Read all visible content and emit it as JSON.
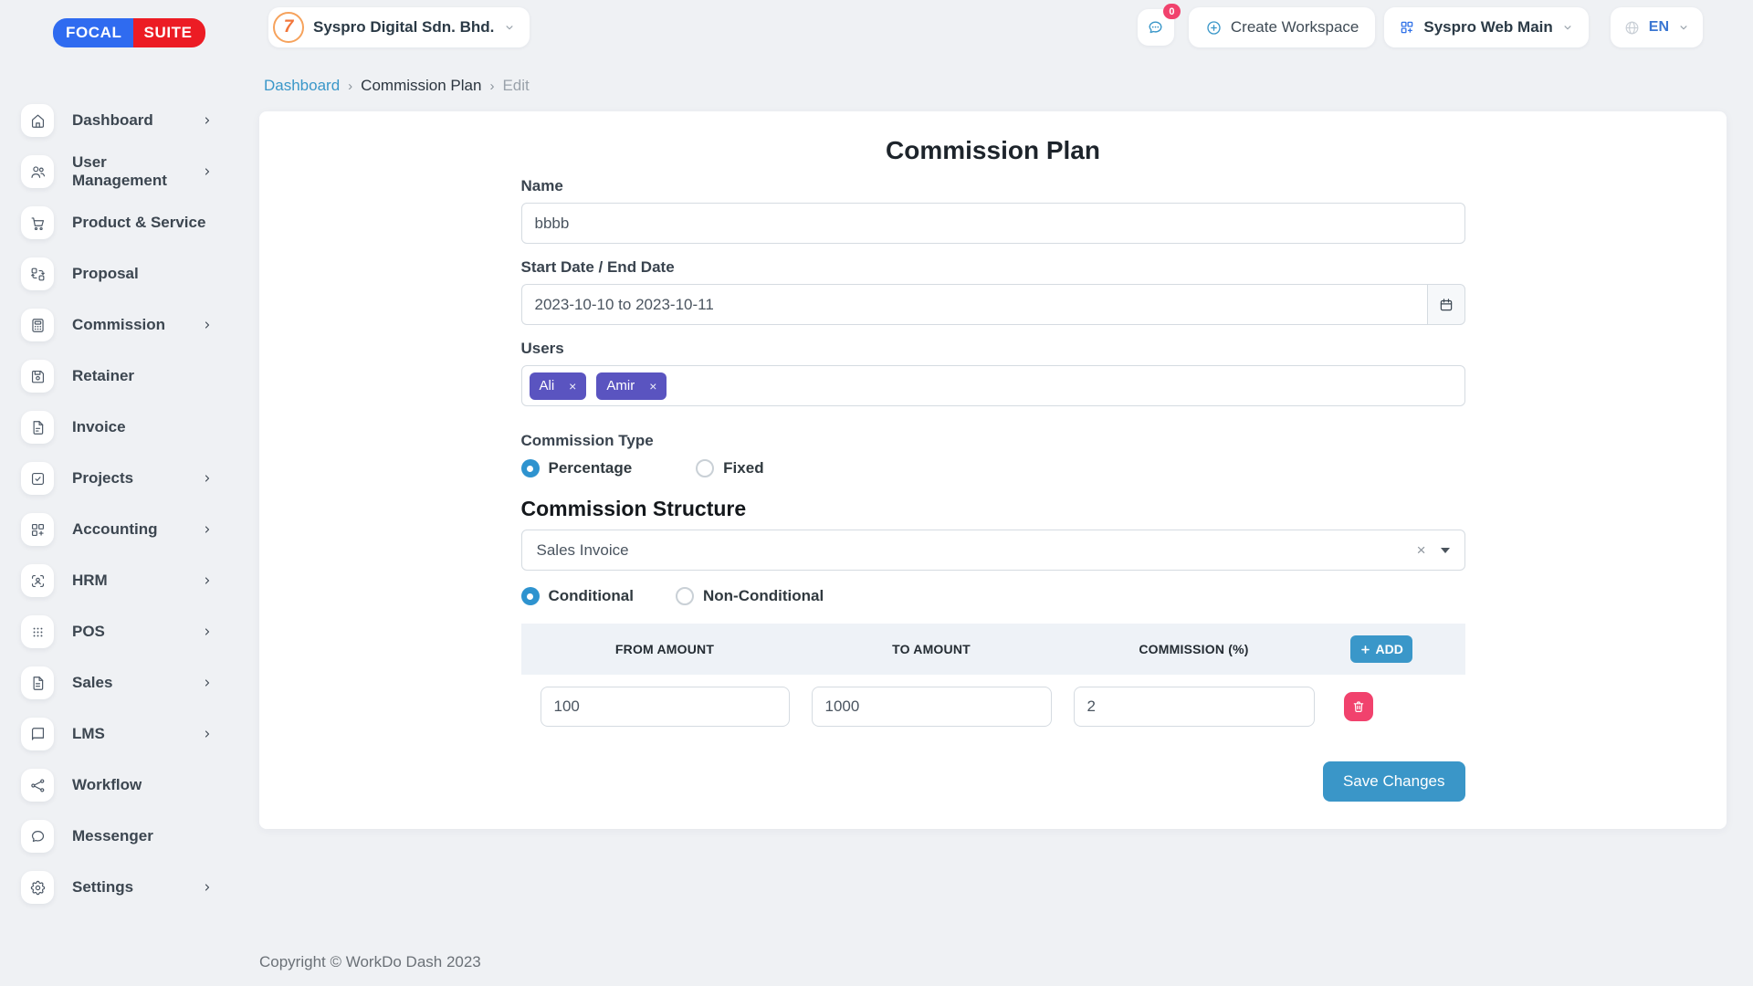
{
  "brand": {
    "focal": "FOCAL",
    "suite": "SUITE"
  },
  "header": {
    "workspace_selector": {
      "name": "Syspro Digital Sdn. Bhd.",
      "logo_glyph": "7"
    },
    "messages_badge": "0",
    "create_workspace_label": "Create Workspace",
    "active_workspace_label": "Syspro Web Main",
    "language_label": "EN"
  },
  "breadcrumb": {
    "items": [
      "Dashboard",
      "Commission Plan",
      "Edit"
    ]
  },
  "sidebar": {
    "items": [
      {
        "label": "Dashboard",
        "icon": "home-icon",
        "has_submenu": true
      },
      {
        "label": "User Management",
        "icon": "users-icon",
        "has_submenu": true
      },
      {
        "label": "Product & Service",
        "icon": "cart-icon",
        "has_submenu": false
      },
      {
        "label": "Proposal",
        "icon": "route-icon",
        "has_submenu": false
      },
      {
        "label": "Commission",
        "icon": "calculator-icon",
        "has_submenu": true
      },
      {
        "label": "Retainer",
        "icon": "floppy-icon",
        "has_submenu": false
      },
      {
        "label": "Invoice",
        "icon": "file-invoice-icon",
        "has_submenu": false
      },
      {
        "label": "Projects",
        "icon": "check-square-icon",
        "has_submenu": true
      },
      {
        "label": "Accounting",
        "icon": "grid-plus-icon",
        "has_submenu": true
      },
      {
        "label": "HRM",
        "icon": "user-scan-icon",
        "has_submenu": true
      },
      {
        "label": "POS",
        "icon": "dots-grid-icon",
        "has_submenu": true
      },
      {
        "label": "Sales",
        "icon": "file-text-icon",
        "has_submenu": true
      },
      {
        "label": "LMS",
        "icon": "book-icon",
        "has_submenu": true
      },
      {
        "label": "Workflow",
        "icon": "workflow-icon",
        "has_submenu": false
      },
      {
        "label": "Messenger",
        "icon": "chat-icon",
        "has_submenu": false
      },
      {
        "label": "Settings",
        "icon": "gear-icon",
        "has_submenu": true
      }
    ]
  },
  "form": {
    "title": "Commission Plan",
    "name": {
      "label": "Name",
      "value": "bbbb"
    },
    "date": {
      "label": "Start Date / End Date",
      "value": "2023-10-10 to 2023-10-11"
    },
    "users": {
      "label": "Users",
      "tags": [
        "Ali",
        "Amir"
      ],
      "remove_glyph": "×"
    },
    "commission_type": {
      "label": "Commission Type",
      "options": [
        "Percentage",
        "Fixed"
      ],
      "selected": "Percentage"
    },
    "structure": {
      "heading": "Commission Structure",
      "select_value": "Sales Invoice",
      "clear_glyph": "×",
      "options": [
        "Conditional",
        "Non-Conditional"
      ],
      "selected": "Conditional"
    },
    "table": {
      "headers": [
        "FROM AMOUNT",
        "TO AMOUNT",
        "COMMISSION (%)"
      ],
      "add_label": "ADD",
      "rows": [
        {
          "from": "100",
          "to": "1000",
          "commission": "2"
        }
      ]
    },
    "save_label": "Save Changes"
  },
  "footer": {
    "copyright": "Copyright © WorkDo Dash 2023"
  },
  "colors": {
    "primary_blue": "#3a96c8",
    "radio_blue": "#2e93cf",
    "tag_purple": "#5a54c0",
    "danger_pink": "#f1426d",
    "logo_blue": "#2f6bf0",
    "logo_red": "#ec1c24",
    "workspace_orange": "#f2753a",
    "table_header_bg": "#eef2f7",
    "page_bg": "#eff1f4"
  }
}
